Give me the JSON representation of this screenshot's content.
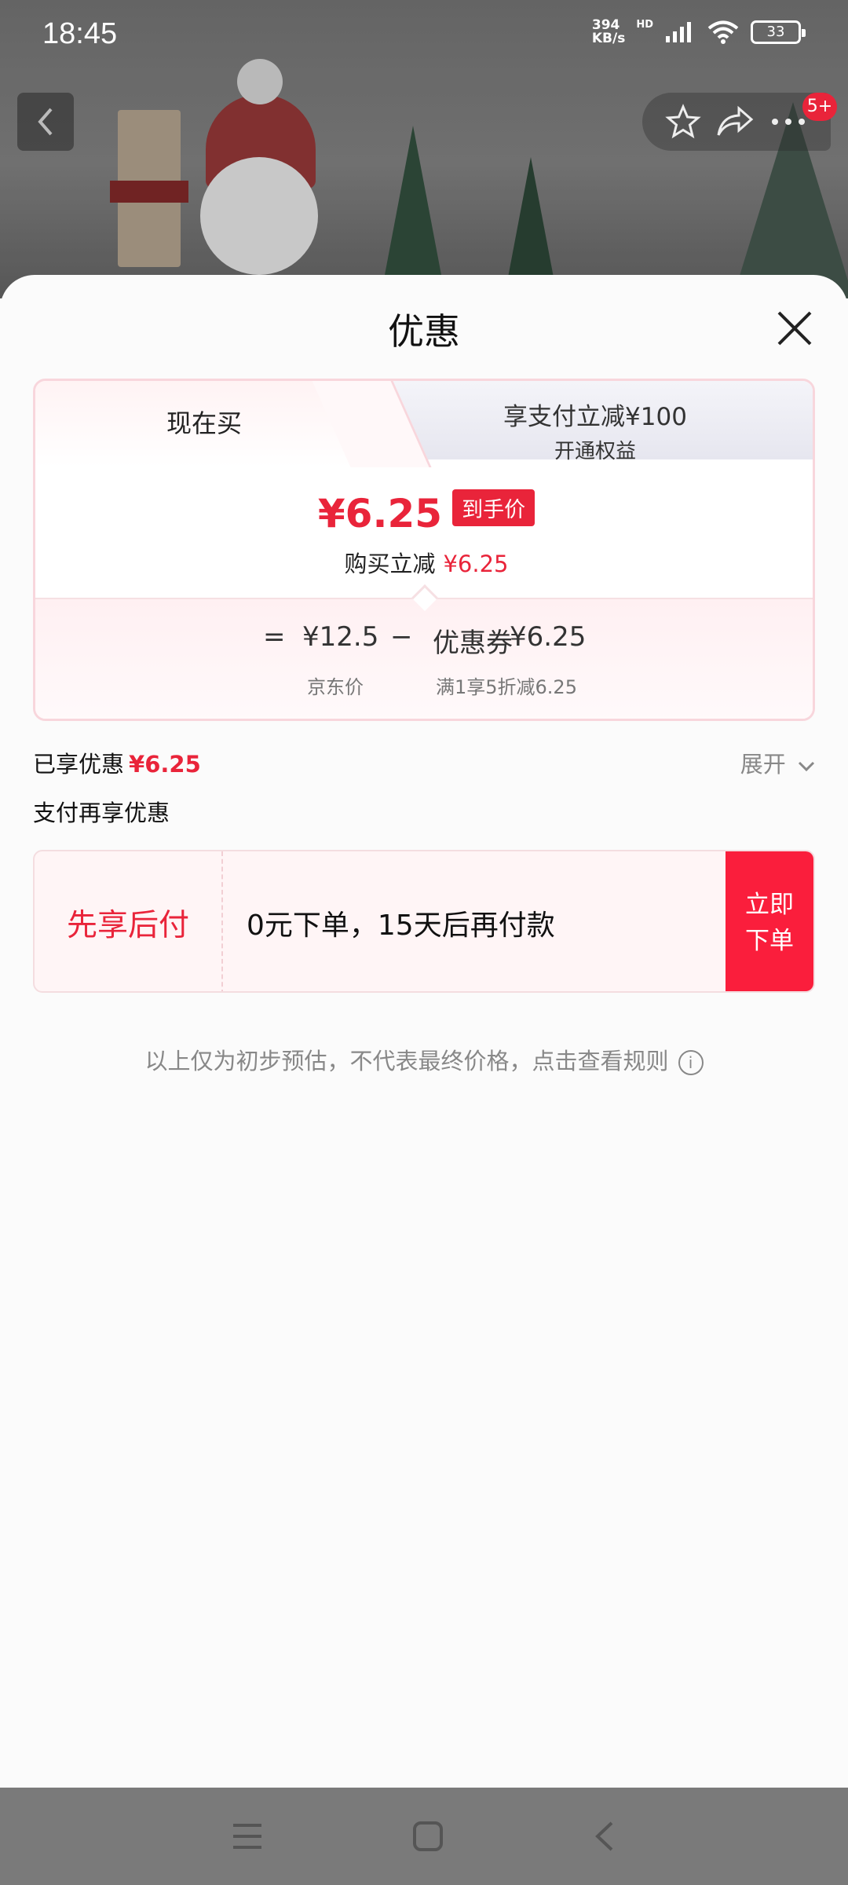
{
  "status_bar": {
    "time": "18:45",
    "net_speed_value": "394",
    "net_speed_unit": "KB/s",
    "hd_label": "HD",
    "battery": "33"
  },
  "top_bar": {
    "more_badge": "5+"
  },
  "sheet": {
    "title": "优惠"
  },
  "tabs": [
    {
      "label": "现在买",
      "active": true
    },
    {
      "label": "享支付立减¥100",
      "sublabel": "开通权益",
      "active": false
    }
  ],
  "price": {
    "final": "¥6.25",
    "final_tag": "到手价",
    "reduce_label": "购买立减",
    "reduce_value": "¥6.25",
    "eq_sign": "=",
    "jd_price": "¥12.5",
    "minus_sign": "−",
    "coupon_label": "优惠券",
    "coupon_value": "¥6.25",
    "jd_price_label": "京东价",
    "coupon_desc": "满1享5折减6.25"
  },
  "enjoyed": {
    "label": "已享优惠",
    "value": "¥6.25",
    "expand_label": "展开"
  },
  "pay_more_label": "支付再享优惠",
  "bnpl": {
    "title": "先享后付",
    "desc": "0元下单，15天后再付款",
    "button": "立即\n下单",
    "button_line1": "立即",
    "button_line2": "下单"
  },
  "disclaimer": "以上仅为初步预估，不代表最终价格，点击查看规则",
  "colors": {
    "accent_red": "#e9243a",
    "button_red": "#fa1e3c"
  }
}
